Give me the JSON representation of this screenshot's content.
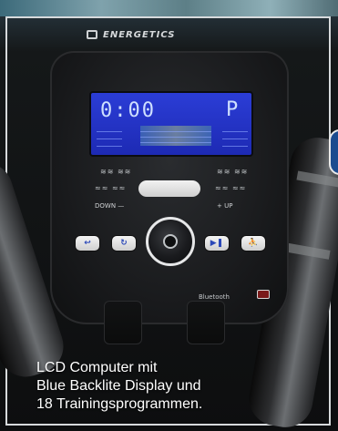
{
  "caption": {
    "line1": "LCD Computer mit",
    "line2": "Blue Backlite Display und",
    "line3": "18 Trainingsprogrammen."
  },
  "console": {
    "brand": "ENERGETICS",
    "lcd": {
      "time_digits": "0:00",
      "program_letter": "P"
    },
    "labels": {
      "down": "DOWN —",
      "up": "+ UP",
      "bluetooth": "Bluetooth"
    }
  },
  "colors": {
    "lcd_blue": "#2b3dd6",
    "badge_blue": "#1b4b8f",
    "caption_text": "#ffffff"
  },
  "icons": {
    "handle_left": "handle-grip-icon",
    "handle_right": "handle-grip-icon",
    "dial": "dial-icon",
    "bluetooth": "bluetooth-icon"
  }
}
